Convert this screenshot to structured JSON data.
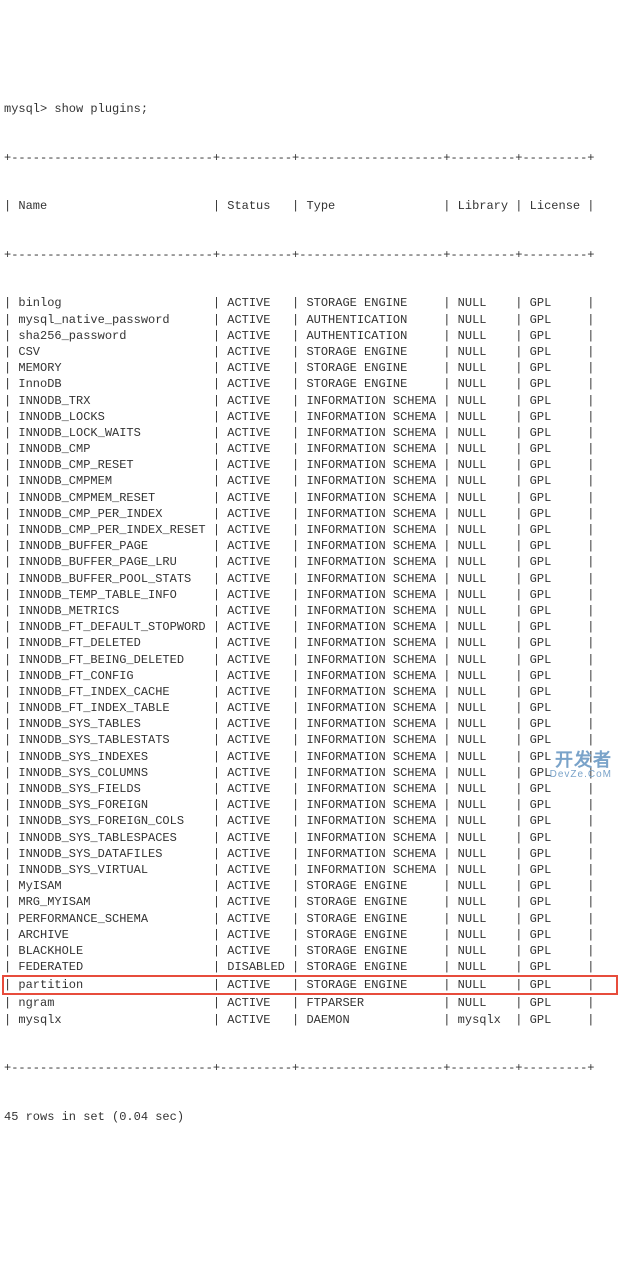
{
  "prompt": "mysql> show plugins;",
  "headers": {
    "name": "Name",
    "status": "Status",
    "type": "Type",
    "library": "Library",
    "license": "License"
  },
  "separator_top": "+----------------------------+----------+--------------------+---------+---------+",
  "rows": [
    {
      "name": "binlog",
      "status": "ACTIVE",
      "type": "STORAGE ENGINE",
      "library": "NULL",
      "license": "GPL",
      "highlight": false
    },
    {
      "name": "mysql_native_password",
      "status": "ACTIVE",
      "type": "AUTHENTICATION",
      "library": "NULL",
      "license": "GPL",
      "highlight": false
    },
    {
      "name": "sha256_password",
      "status": "ACTIVE",
      "type": "AUTHENTICATION",
      "library": "NULL",
      "license": "GPL",
      "highlight": false
    },
    {
      "name": "CSV",
      "status": "ACTIVE",
      "type": "STORAGE ENGINE",
      "library": "NULL",
      "license": "GPL",
      "highlight": false
    },
    {
      "name": "MEMORY",
      "status": "ACTIVE",
      "type": "STORAGE ENGINE",
      "library": "NULL",
      "license": "GPL",
      "highlight": false
    },
    {
      "name": "InnoDB",
      "status": "ACTIVE",
      "type": "STORAGE ENGINE",
      "library": "NULL",
      "license": "GPL",
      "highlight": false
    },
    {
      "name": "INNODB_TRX",
      "status": "ACTIVE",
      "type": "INFORMATION SCHEMA",
      "library": "NULL",
      "license": "GPL",
      "highlight": false
    },
    {
      "name": "INNODB_LOCKS",
      "status": "ACTIVE",
      "type": "INFORMATION SCHEMA",
      "library": "NULL",
      "license": "GPL",
      "highlight": false
    },
    {
      "name": "INNODB_LOCK_WAITS",
      "status": "ACTIVE",
      "type": "INFORMATION SCHEMA",
      "library": "NULL",
      "license": "GPL",
      "highlight": false
    },
    {
      "name": "INNODB_CMP",
      "status": "ACTIVE",
      "type": "INFORMATION SCHEMA",
      "library": "NULL",
      "license": "GPL",
      "highlight": false
    },
    {
      "name": "INNODB_CMP_RESET",
      "status": "ACTIVE",
      "type": "INFORMATION SCHEMA",
      "library": "NULL",
      "license": "GPL",
      "highlight": false
    },
    {
      "name": "INNODB_CMPMEM",
      "status": "ACTIVE",
      "type": "INFORMATION SCHEMA",
      "library": "NULL",
      "license": "GPL",
      "highlight": false
    },
    {
      "name": "INNODB_CMPMEM_RESET",
      "status": "ACTIVE",
      "type": "INFORMATION SCHEMA",
      "library": "NULL",
      "license": "GPL",
      "highlight": false
    },
    {
      "name": "INNODB_CMP_PER_INDEX",
      "status": "ACTIVE",
      "type": "INFORMATION SCHEMA",
      "library": "NULL",
      "license": "GPL",
      "highlight": false
    },
    {
      "name": "INNODB_CMP_PER_INDEX_RESET",
      "status": "ACTIVE",
      "type": "INFORMATION SCHEMA",
      "library": "NULL",
      "license": "GPL",
      "highlight": false
    },
    {
      "name": "INNODB_BUFFER_PAGE",
      "status": "ACTIVE",
      "type": "INFORMATION SCHEMA",
      "library": "NULL",
      "license": "GPL",
      "highlight": false
    },
    {
      "name": "INNODB_BUFFER_PAGE_LRU",
      "status": "ACTIVE",
      "type": "INFORMATION SCHEMA",
      "library": "NULL",
      "license": "GPL",
      "highlight": false
    },
    {
      "name": "INNODB_BUFFER_POOL_STATS",
      "status": "ACTIVE",
      "type": "INFORMATION SCHEMA",
      "library": "NULL",
      "license": "GPL",
      "highlight": false
    },
    {
      "name": "INNODB_TEMP_TABLE_INFO",
      "status": "ACTIVE",
      "type": "INFORMATION SCHEMA",
      "library": "NULL",
      "license": "GPL",
      "highlight": false
    },
    {
      "name": "INNODB_METRICS",
      "status": "ACTIVE",
      "type": "INFORMATION SCHEMA",
      "library": "NULL",
      "license": "GPL",
      "highlight": false
    },
    {
      "name": "INNODB_FT_DEFAULT_STOPWORD",
      "status": "ACTIVE",
      "type": "INFORMATION SCHEMA",
      "library": "NULL",
      "license": "GPL",
      "highlight": false
    },
    {
      "name": "INNODB_FT_DELETED",
      "status": "ACTIVE",
      "type": "INFORMATION SCHEMA",
      "library": "NULL",
      "license": "GPL",
      "highlight": false
    },
    {
      "name": "INNODB_FT_BEING_DELETED",
      "status": "ACTIVE",
      "type": "INFORMATION SCHEMA",
      "library": "NULL",
      "license": "GPL",
      "highlight": false
    },
    {
      "name": "INNODB_FT_CONFIG",
      "status": "ACTIVE",
      "type": "INFORMATION SCHEMA",
      "library": "NULL",
      "license": "GPL",
      "highlight": false
    },
    {
      "name": "INNODB_FT_INDEX_CACHE",
      "status": "ACTIVE",
      "type": "INFORMATION SCHEMA",
      "library": "NULL",
      "license": "GPL",
      "highlight": false
    },
    {
      "name": "INNODB_FT_INDEX_TABLE",
      "status": "ACTIVE",
      "type": "INFORMATION SCHEMA",
      "library": "NULL",
      "license": "GPL",
      "highlight": false
    },
    {
      "name": "INNODB_SYS_TABLES",
      "status": "ACTIVE",
      "type": "INFORMATION SCHEMA",
      "library": "NULL",
      "license": "GPL",
      "highlight": false
    },
    {
      "name": "INNODB_SYS_TABLESTATS",
      "status": "ACTIVE",
      "type": "INFORMATION SCHEMA",
      "library": "NULL",
      "license": "GPL",
      "highlight": false
    },
    {
      "name": "INNODB_SYS_INDEXES",
      "status": "ACTIVE",
      "type": "INFORMATION SCHEMA",
      "library": "NULL",
      "license": "GPL",
      "highlight": false
    },
    {
      "name": "INNODB_SYS_COLUMNS",
      "status": "ACTIVE",
      "type": "INFORMATION SCHEMA",
      "library": "NULL",
      "license": "GPL",
      "highlight": false
    },
    {
      "name": "INNODB_SYS_FIELDS",
      "status": "ACTIVE",
      "type": "INFORMATION SCHEMA",
      "library": "NULL",
      "license": "GPL",
      "highlight": false
    },
    {
      "name": "INNODB_SYS_FOREIGN",
      "status": "ACTIVE",
      "type": "INFORMATION SCHEMA",
      "library": "NULL",
      "license": "GPL",
      "highlight": false
    },
    {
      "name": "INNODB_SYS_FOREIGN_COLS",
      "status": "ACTIVE",
      "type": "INFORMATION SCHEMA",
      "library": "NULL",
      "license": "GPL",
      "highlight": false
    },
    {
      "name": "INNODB_SYS_TABLESPACES",
      "status": "ACTIVE",
      "type": "INFORMATION SCHEMA",
      "library": "NULL",
      "license": "GPL",
      "highlight": false
    },
    {
      "name": "INNODB_SYS_DATAFILES",
      "status": "ACTIVE",
      "type": "INFORMATION SCHEMA",
      "library": "NULL",
      "license": "GPL",
      "highlight": false
    },
    {
      "name": "INNODB_SYS_VIRTUAL",
      "status": "ACTIVE",
      "type": "INFORMATION SCHEMA",
      "library": "NULL",
      "license": "GPL",
      "highlight": false
    },
    {
      "name": "MyISAM",
      "status": "ACTIVE",
      "type": "STORAGE ENGINE",
      "library": "NULL",
      "license": "GPL",
      "highlight": false
    },
    {
      "name": "MRG_MYISAM",
      "status": "ACTIVE",
      "type": "STORAGE ENGINE",
      "library": "NULL",
      "license": "GPL",
      "highlight": false
    },
    {
      "name": "PERFORMANCE_SCHEMA",
      "status": "ACTIVE",
      "type": "STORAGE ENGINE",
      "library": "NULL",
      "license": "GPL",
      "highlight": false
    },
    {
      "name": "ARCHIVE",
      "status": "ACTIVE",
      "type": "STORAGE ENGINE",
      "library": "NULL",
      "license": "GPL",
      "highlight": false
    },
    {
      "name": "BLACKHOLE",
      "status": "ACTIVE",
      "type": "STORAGE ENGINE",
      "library": "NULL",
      "license": "GPL",
      "highlight": false
    },
    {
      "name": "FEDERATED",
      "status": "DISABLED",
      "type": "STORAGE ENGINE",
      "library": "NULL",
      "license": "GPL",
      "highlight": false
    },
    {
      "name": "partition",
      "status": "ACTIVE",
      "type": "STORAGE ENGINE",
      "library": "NULL",
      "license": "GPL",
      "highlight": true
    },
    {
      "name": "ngram",
      "status": "ACTIVE",
      "type": "FTPARSER",
      "library": "NULL",
      "license": "GPL",
      "highlight": false
    },
    {
      "name": "mysqlx",
      "status": "ACTIVE",
      "type": "DAEMON",
      "library": "mysqlx",
      "license": "GPL",
      "highlight": false
    }
  ],
  "footer": "45 rows in set (0.04 sec)",
  "watermark": {
    "main": "开发者",
    "sub": "DevZe.CoM"
  }
}
